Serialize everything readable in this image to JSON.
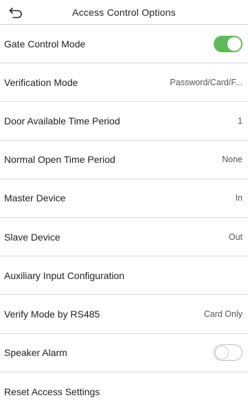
{
  "header": {
    "title": "Access Control Options",
    "back_icon": "back-arrow-icon"
  },
  "items": [
    {
      "label": "Gate Control Mode",
      "control": "toggle",
      "state": "on",
      "accent": "#5fb95a"
    },
    {
      "label": "Verification Mode",
      "control": "value",
      "value": "Password/Card/F..."
    },
    {
      "label": "Door Available Time Period",
      "control": "value",
      "value": "1"
    },
    {
      "label": "Normal Open Time Period",
      "control": "value",
      "value": "None"
    },
    {
      "label": "Master Device",
      "control": "value",
      "value": "In"
    },
    {
      "label": "Slave Device",
      "control": "value",
      "value": "Out"
    },
    {
      "label": "Auxiliary Input Configuration",
      "control": "none"
    },
    {
      "label": "Verify Mode by RS485",
      "control": "value",
      "value": "Card Only"
    },
    {
      "label": "Speaker Alarm",
      "control": "toggle",
      "state": "off"
    },
    {
      "label": "Reset Access Settings",
      "control": "none"
    }
  ]
}
